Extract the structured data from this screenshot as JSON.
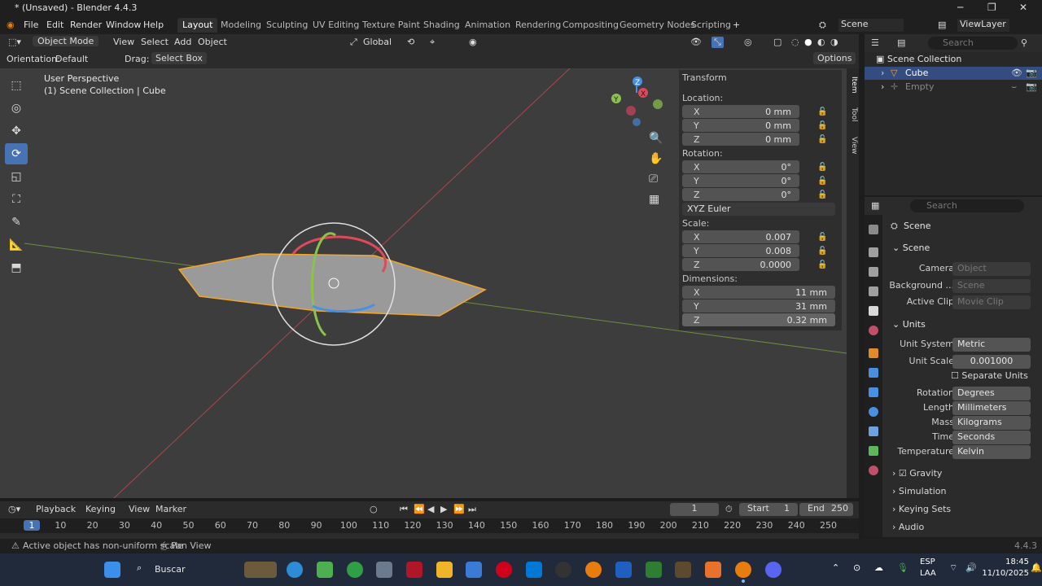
{
  "window": {
    "title": "* (Unsaved) - Blender 4.4.3"
  },
  "menu": {
    "items": [
      "File",
      "Edit",
      "Render",
      "Window",
      "Help"
    ]
  },
  "workspaces": [
    "Layout",
    "Modeling",
    "Sculpting",
    "UV Editing",
    "Texture Paint",
    "Shading",
    "Animation",
    "Rendering",
    "Compositing",
    "Geometry Nodes",
    "Scripting"
  ],
  "active_workspace": "Layout",
  "scene_selector": "Scene",
  "viewlayer_selector": "ViewLayer",
  "viewport_header": {
    "mode": "Object Mode",
    "view": "View",
    "select": "Select",
    "add": "Add",
    "object": "Object",
    "transform_space": "Global"
  },
  "viewport_sub": {
    "orientation_label": "Orientation:",
    "orientation_value": "Default",
    "drag_label": "Drag:",
    "drag_value": "Select Box",
    "options": "Options"
  },
  "viewport_info": {
    "perspective": "User Perspective",
    "collection": "(1) Scene Collection | Cube"
  },
  "npanel": {
    "transform_title": "Transform",
    "location_label": "Location:",
    "location": [
      {
        "axis": "X",
        "value": "0 mm"
      },
      {
        "axis": "Y",
        "value": "0 mm"
      },
      {
        "axis": "Z",
        "value": "0 mm"
      }
    ],
    "rotation_label": "Rotation:",
    "rotation": [
      {
        "axis": "X",
        "value": "0°"
      },
      {
        "axis": "Y",
        "value": "0°"
      },
      {
        "axis": "Z",
        "value": "0°"
      }
    ],
    "rotation_mode": "XYZ Euler",
    "scale_label": "Scale:",
    "scale": [
      {
        "axis": "X",
        "value": "0.007"
      },
      {
        "axis": "Y",
        "value": "0.008"
      },
      {
        "axis": "Z",
        "value": "0.0000"
      }
    ],
    "dimensions_label": "Dimensions:",
    "dimensions": [
      {
        "axis": "X",
        "value": "11 mm"
      },
      {
        "axis": "Y",
        "value": "31 mm"
      },
      {
        "axis": "Z",
        "value": "0.32 mm"
      }
    ],
    "tabs": [
      "Item",
      "Tool",
      "View"
    ]
  },
  "outliner": {
    "search_placeholder": "Search",
    "root": "Scene Collection",
    "items": [
      {
        "name": "Cube",
        "selected": true
      },
      {
        "name": "Empty",
        "selected": false
      }
    ]
  },
  "properties": {
    "search_placeholder": "Search",
    "header": "Scene",
    "scene_panel": {
      "title": "Scene",
      "camera_label": "Camera",
      "camera_value": "Object",
      "background_label": "Background ...",
      "background_value": "Scene",
      "active_clip_label": "Active Clip",
      "active_clip_value": "Movie Clip"
    },
    "units_panel": {
      "title": "Units",
      "unit_system_label": "Unit System",
      "unit_system": "Metric",
      "unit_scale_label": "Unit Scale",
      "unit_scale": "0.001000",
      "separate_units": "Separate Units",
      "rotation_label": "Rotation",
      "rotation": "Degrees",
      "length_label": "Length",
      "length": "Millimeters",
      "mass_label": "Mass",
      "mass": "Kilograms",
      "time_label": "Time",
      "time": "Seconds",
      "temperature_label": "Temperature",
      "temperature": "Kelvin"
    },
    "collapsed_panels": [
      "Gravity",
      "Simulation",
      "Keying Sets",
      "Audio"
    ]
  },
  "timeline": {
    "playback": "Playback",
    "keying": "Keying",
    "view": "View",
    "marker": "Marker",
    "current_frame": "1",
    "start_label": "Start",
    "start": "1",
    "end_label": "End",
    "end": "250",
    "ruler": [
      "1",
      "10",
      "20",
      "30",
      "40",
      "50",
      "60",
      "70",
      "80",
      "90",
      "100",
      "110",
      "120",
      "130",
      "140",
      "150",
      "160",
      "170",
      "180",
      "190",
      "200",
      "210",
      "220",
      "230",
      "240",
      "250"
    ]
  },
  "status": {
    "message": "Active object has non-uniform scale",
    "pan": "Pan View",
    "version": "4.4.3"
  },
  "taskbar": {
    "search": "Buscar",
    "lang1": "ESP",
    "lang2": "LAA",
    "time": "18:45",
    "date": "11/10/2025"
  },
  "colors": {
    "accent": "#4772b3",
    "selection_orange": "#f5a623",
    "axis_red": "#e0485c",
    "axis_green": "#8bc34a",
    "axis_blue": "#4a90e2"
  }
}
